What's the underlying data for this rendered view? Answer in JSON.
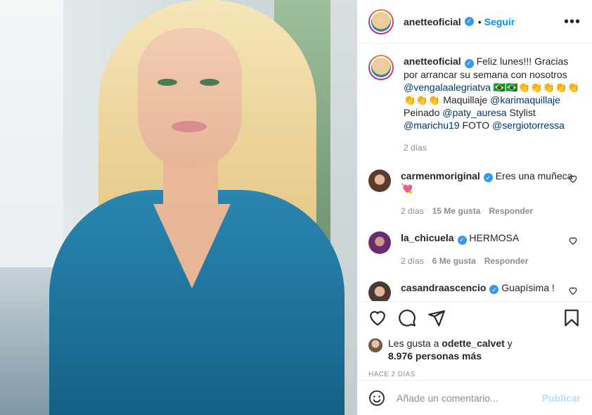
{
  "post": {
    "photo_alt": "",
    "author": "anetteoficial",
    "follow_separator": "•",
    "follow_label": "Seguir",
    "more_label": "•••"
  },
  "caption": {
    "author": "anetteoficial",
    "text_1": "Feliz lunes!!! Gracias por arrancar su semana con nosotros",
    "mention_1": "@vengalaalegriatva",
    "emoji_1": "🇧🇷🇧🇷👏👏👏👏👏👏👏👏",
    "text_2": "Maquillaje",
    "mention_2": "@karimaquillaje",
    "text_3": "Peinado",
    "mention_3": "@paty_auresa",
    "text_4": "Stylist",
    "mention_4": "@marichu19",
    "text_5": "FOTO",
    "mention_5": "@sergiotorressa",
    "time": "2 días"
  },
  "comments": [
    {
      "user": "carmenmoriginal",
      "text": "Eres una muñeca 💘",
      "time": "2 días",
      "likes": "15 Me gusta",
      "reply": "Responder"
    },
    {
      "user": "la_chicuela",
      "text": "HERMOSA",
      "time": "2 días",
      "likes": "6 Me gusta",
      "reply": "Responder"
    },
    {
      "user": "casandraascencio",
      "text": "Guapísima !",
      "time": "",
      "likes": "",
      "reply": ""
    }
  ],
  "likes": {
    "prefix": "Les gusta a",
    "user": "odette_calvet",
    "suffix": "y",
    "count": "8.976 personas más"
  },
  "posted_ago": "HACE 2 DÍAS",
  "add_comment": {
    "placeholder": "Añade un comentario...",
    "publish_label": "Publicar"
  },
  "icons": [
    "heart-icon",
    "comment-icon",
    "share-icon",
    "bookmark-icon",
    "emoji-icon",
    "verified-icon",
    "more-icon"
  ],
  "colors": {
    "link": "#0095f6",
    "mention": "#00376b",
    "muted": "#8e8e8e",
    "verified": "#3897f0",
    "publish_disabled": "#b2dffc"
  }
}
